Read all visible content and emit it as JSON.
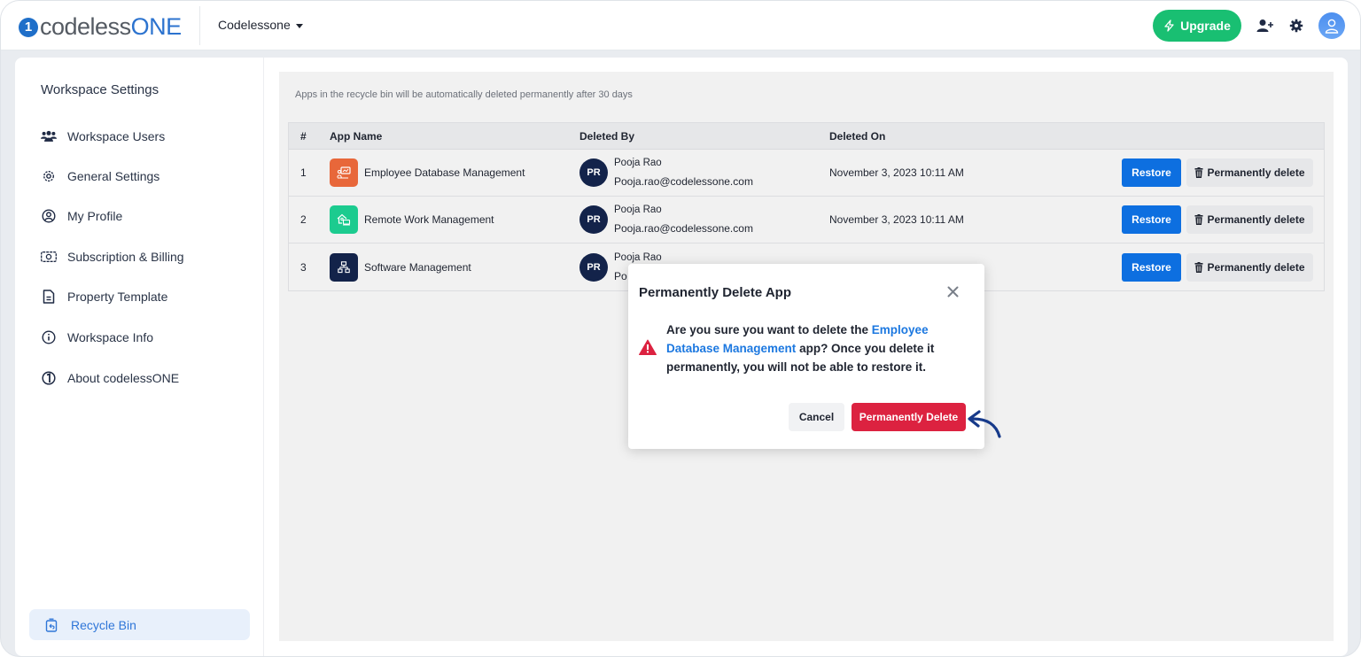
{
  "header": {
    "logo_text_a": "codeless",
    "logo_text_b": "ONE",
    "logo_mark": "1",
    "workspace_name": "Codelessone",
    "upgrade_label": "Upgrade",
    "icons": [
      "lightning-icon",
      "add-user-icon",
      "gear-icon",
      "user-avatar-icon"
    ]
  },
  "sidebar": {
    "title": "Workspace Settings",
    "items": [
      {
        "label": "Workspace Users",
        "icon": "users-icon"
      },
      {
        "label": "General Settings",
        "icon": "gear-outline-icon"
      },
      {
        "label": "My Profile",
        "icon": "profile-circle-icon"
      },
      {
        "label": "Subscription & Billing",
        "icon": "money-icon"
      },
      {
        "label": "Property Template",
        "icon": "document-icon"
      },
      {
        "label": "Workspace Info",
        "icon": "info-icon"
      },
      {
        "label": "About codelessONE",
        "icon": "codelessone-icon"
      }
    ],
    "active_item": {
      "label": "Recycle Bin",
      "icon": "recycle-bin-icon"
    }
  },
  "main": {
    "notice": "Apps in the recycle bin will be automatically deleted permanently after 30 days",
    "table": {
      "columns": [
        "#",
        "App Name",
        "Deleted By",
        "Deleted On",
        ""
      ],
      "rows": [
        {
          "num": "1",
          "app_name": "Employee Database Management",
          "app_color": "#e8673a",
          "app_icon": "presentation-icon",
          "avatar_initials": "PR",
          "deleted_by_name": "Pooja Rao",
          "deleted_by_email": "Pooja.rao@codelessone.com",
          "deleted_on": "November 3, 2023 10:11 AM",
          "restore_label": "Restore",
          "delete_label": "Permanently delete"
        },
        {
          "num": "2",
          "app_name": "Remote Work Management",
          "app_color": "#1ccb8f",
          "app_icon": "home-office-icon",
          "avatar_initials": "PR",
          "deleted_by_name": "Pooja Rao",
          "deleted_by_email": "Pooja.rao@codelessone.com",
          "deleted_on": "November 3, 2023 10:11 AM",
          "restore_label": "Restore",
          "delete_label": "Permanently delete"
        },
        {
          "num": "3",
          "app_name": "Software Management",
          "app_color": "#13234a",
          "app_icon": "network-icon",
          "avatar_initials": "PR",
          "deleted_by_name": "Pooja Rao",
          "deleted_by_email": "Po",
          "deleted_on": "",
          "restore_label": "Restore",
          "delete_label": "Permanently delete"
        }
      ]
    }
  },
  "modal": {
    "title": "Permanently Delete App",
    "body_prefix": "Are you sure you want to delete the ",
    "app_name": "Employee Database Management",
    "body_suffix": " app? Once you delete it permanently, you will not be able to restore it.",
    "cancel_label": "Cancel",
    "confirm_label": "Permanently Delete"
  },
  "colors": {
    "brand_blue": "#2c73cf",
    "upgrade_green": "#19bf72",
    "restore_blue": "#0d6fe0",
    "danger_red": "#dc2240",
    "link_blue": "#1c78e0",
    "avatar_navy": "#13234a"
  }
}
